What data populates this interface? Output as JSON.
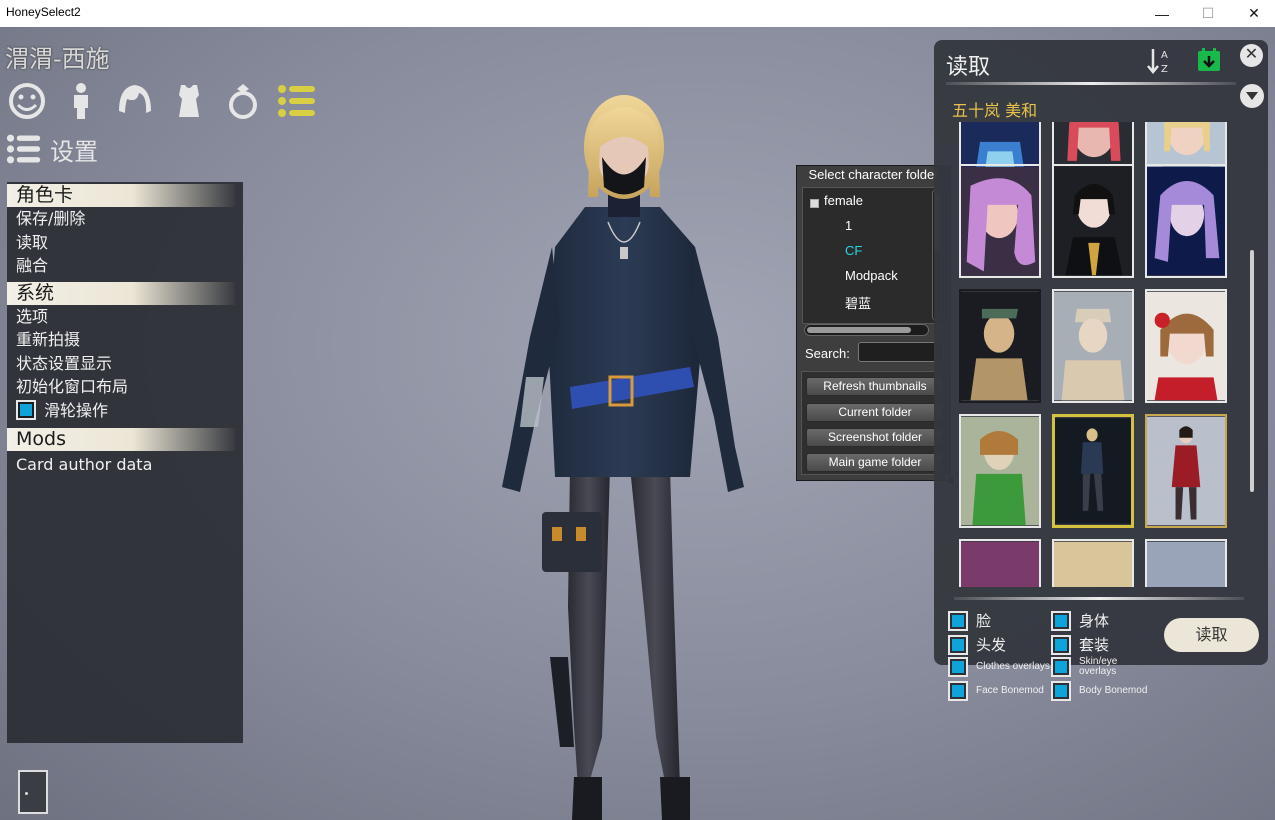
{
  "window": {
    "title": "HoneySelect2",
    "min_glyph": "—",
    "max_glyph": "☐",
    "close_glyph": "✕"
  },
  "character_name": "渭渭-西施",
  "category_icons": [
    "face-icon",
    "body-icon",
    "hair-icon",
    "clothes-icon",
    "accessory-icon",
    "settings-list-icon"
  ],
  "settings_label": "设置",
  "menu": {
    "sections": [
      {
        "header": "角色卡",
        "items": [
          "保存/删除",
          "读取",
          "融合"
        ]
      },
      {
        "header": "系统",
        "items": [
          "选项",
          "重新拍摄",
          "状态设置显示",
          "初始化窗口布局"
        ],
        "checkbox_item": "滑轮操作"
      },
      {
        "header": "Mods",
        "items": [
          "Card author data"
        ]
      }
    ]
  },
  "folder_window": {
    "title": "Select character folder",
    "root": "female",
    "children": [
      "1",
      "CF",
      "Modpack",
      "碧蓝"
    ],
    "selected": "CF",
    "search_label": "Search:",
    "search_value": "",
    "buttons": [
      "Refresh thumbnails",
      "Current folder",
      "Screenshot folder",
      "Main game folder"
    ]
  },
  "load_panel": {
    "title": "读取",
    "close_glyph": "✕",
    "folder_name": "五十岚 美和",
    "options": [
      {
        "label": "脸",
        "size": "big"
      },
      {
        "label": "身体",
        "size": "big"
      },
      {
        "label": "头发",
        "size": "big"
      },
      {
        "label": "套装",
        "size": "big"
      },
      {
        "label": "Clothes overlays",
        "size": "small"
      },
      {
        "label": "Skin/eye overlays",
        "size": "small"
      },
      {
        "label": "Face Bonemod",
        "size": "small"
      },
      {
        "label": "Body Bonemod",
        "size": "small"
      }
    ],
    "load_button": "读取"
  },
  "colors": {
    "accent_checkbox": "#0ea4d9",
    "folder_selected": "#26d7e6",
    "folder_name": "#e8c24a",
    "selected_card_border": "#d4c23e",
    "menu_icon_highlight": "#d8cf45"
  }
}
